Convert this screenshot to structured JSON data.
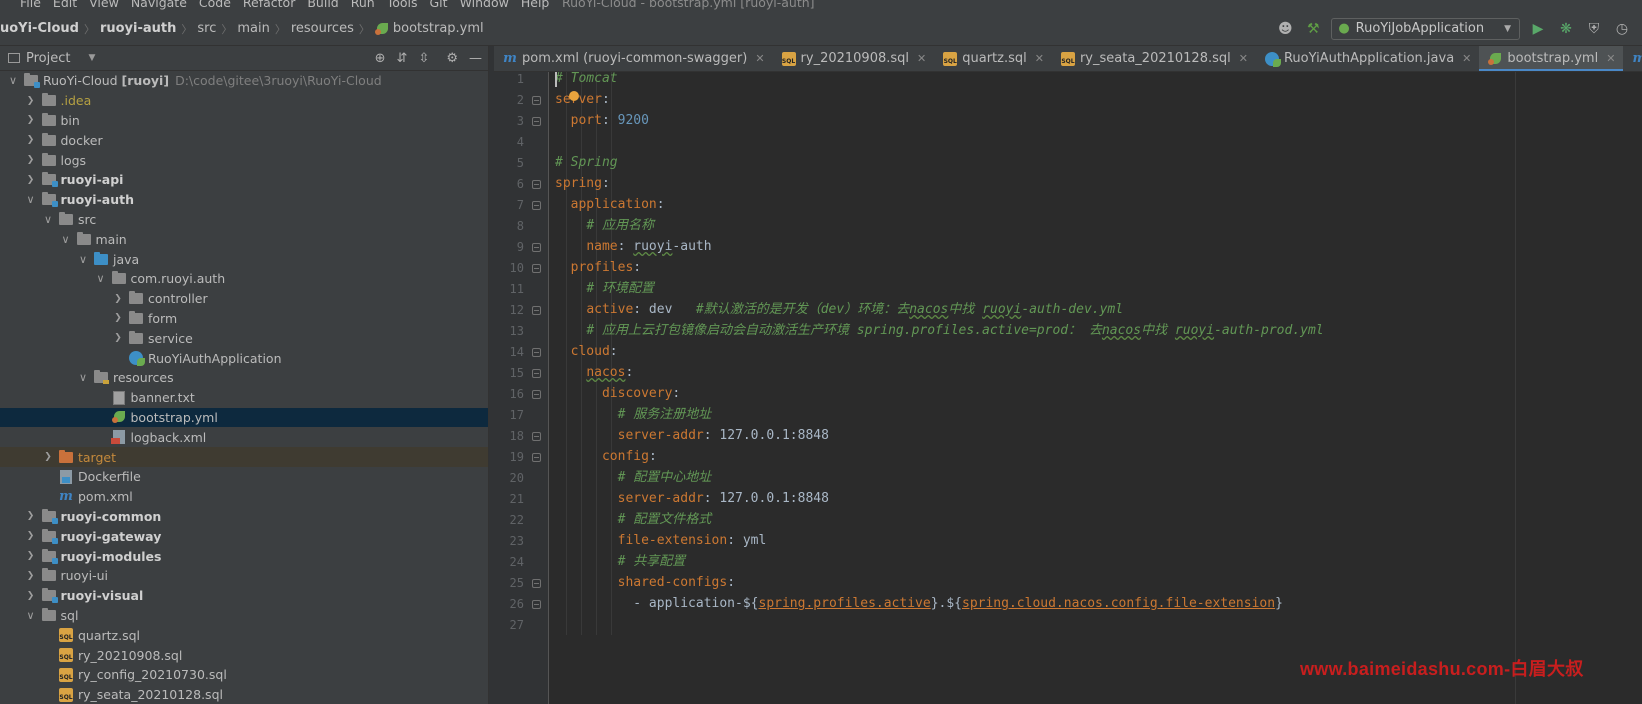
{
  "menubar": {
    "items": [
      "File",
      "Edit",
      "View",
      "Navigate",
      "Code",
      "Refactor",
      "Build",
      "Run",
      "Tools",
      "Git",
      "Window",
      "Help"
    ],
    "window_title": "RuoYi-Cloud - bootstrap.yml [ruoyi-auth]"
  },
  "breadcrumbs": [
    "uoYi-Cloud",
    "ruoyi-auth",
    "src",
    "main",
    "resources",
    "bootstrap.yml"
  ],
  "toolbar": {
    "run_config": "RuoYiJobApplication",
    "icons": [
      "user-icon",
      "hammer-icon",
      "run-icon",
      "debug-icon",
      "coverage-icon",
      "profile-icon"
    ]
  },
  "project_panel": {
    "title": "Project",
    "tree": [
      {
        "label": "RuoYi-Cloud [ruoyi]",
        "hint": "D:\\code\\gitee\\3ruoyi\\RuoYi-Cloud",
        "depth": 0,
        "arrow": "down",
        "icon": "module-folder",
        "style": "normal"
      },
      {
        "label": ".idea",
        "depth": 1,
        "arrow": "right",
        "icon": "folder",
        "style": "yellow"
      },
      {
        "label": "bin",
        "depth": 1,
        "arrow": "right",
        "icon": "folder",
        "style": "normal"
      },
      {
        "label": "docker",
        "depth": 1,
        "arrow": "right",
        "icon": "folder",
        "style": "normal"
      },
      {
        "label": "logs",
        "depth": 1,
        "arrow": "right",
        "icon": "folder",
        "style": "normal"
      },
      {
        "label": "ruoyi-api",
        "depth": 1,
        "arrow": "right",
        "icon": "module-folder",
        "style": "bold"
      },
      {
        "label": "ruoyi-auth",
        "depth": 1,
        "arrow": "down",
        "icon": "module-folder",
        "style": "bold"
      },
      {
        "label": "src",
        "depth": 2,
        "arrow": "down",
        "icon": "folder",
        "style": "normal"
      },
      {
        "label": "main",
        "depth": 3,
        "arrow": "down",
        "icon": "folder",
        "style": "normal"
      },
      {
        "label": "java",
        "depth": 4,
        "arrow": "down",
        "icon": "blue-folder",
        "style": "normal"
      },
      {
        "label": "com.ruoyi.auth",
        "depth": 5,
        "arrow": "down",
        "icon": "package",
        "style": "normal"
      },
      {
        "label": "controller",
        "depth": 6,
        "arrow": "right",
        "icon": "package",
        "style": "normal"
      },
      {
        "label": "form",
        "depth": 6,
        "arrow": "right",
        "icon": "package",
        "style": "normal"
      },
      {
        "label": "service",
        "depth": 6,
        "arrow": "right",
        "icon": "package",
        "style": "normal"
      },
      {
        "label": "RuoYiAuthApplication",
        "depth": 6,
        "arrow": "none",
        "icon": "class",
        "style": "normal"
      },
      {
        "label": "resources",
        "depth": 4,
        "arrow": "down",
        "icon": "resources-folder",
        "style": "normal"
      },
      {
        "label": "banner.txt",
        "depth": 5,
        "arrow": "none",
        "icon": "txt",
        "style": "normal"
      },
      {
        "label": "bootstrap.yml",
        "depth": 5,
        "arrow": "none",
        "icon": "yml",
        "style": "normal",
        "selected": true
      },
      {
        "label": "logback.xml",
        "depth": 5,
        "arrow": "none",
        "icon": "xml",
        "style": "normal"
      },
      {
        "label": "target",
        "depth": 2,
        "arrow": "right",
        "icon": "orange-folder",
        "style": "orange",
        "excluded": true
      },
      {
        "label": "Dockerfile",
        "depth": 2,
        "arrow": "none",
        "icon": "docker",
        "style": "normal"
      },
      {
        "label": "pom.xml",
        "depth": 2,
        "arrow": "none",
        "icon": "pom",
        "style": "normal"
      },
      {
        "label": "ruoyi-common",
        "depth": 1,
        "arrow": "right",
        "icon": "module-folder",
        "style": "bold"
      },
      {
        "label": "ruoyi-gateway",
        "depth": 1,
        "arrow": "right",
        "icon": "module-folder",
        "style": "bold"
      },
      {
        "label": "ruoyi-modules",
        "depth": 1,
        "arrow": "right",
        "icon": "module-folder",
        "style": "bold"
      },
      {
        "label": "ruoyi-ui",
        "depth": 1,
        "arrow": "right",
        "icon": "folder",
        "style": "normal"
      },
      {
        "label": "ruoyi-visual",
        "depth": 1,
        "arrow": "right",
        "icon": "module-folder",
        "style": "bold"
      },
      {
        "label": "sql",
        "depth": 1,
        "arrow": "down",
        "icon": "folder",
        "style": "normal"
      },
      {
        "label": "quartz.sql",
        "depth": 2,
        "arrow": "none",
        "icon": "sql",
        "style": "normal"
      },
      {
        "label": "ry_20210908.sql",
        "depth": 2,
        "arrow": "none",
        "icon": "sql",
        "style": "normal"
      },
      {
        "label": "ry_config_20210730.sql",
        "depth": 2,
        "arrow": "none",
        "icon": "sql",
        "style": "normal"
      },
      {
        "label": "ry_seata_20210128.sql",
        "depth": 2,
        "arrow": "none",
        "icon": "sql",
        "style": "normal"
      }
    ]
  },
  "tabs": [
    {
      "label": "pom.xml (ruoyi-common-swagger)",
      "icon": "pom",
      "active": false
    },
    {
      "label": "ry_20210908.sql",
      "icon": "sql",
      "active": false
    },
    {
      "label": "quartz.sql",
      "icon": "sql",
      "active": false
    },
    {
      "label": "ry_seata_20210128.sql",
      "icon": "sql",
      "active": false
    },
    {
      "label": "RuoYiAuthApplication.java",
      "icon": "class",
      "active": false
    },
    {
      "label": "bootstrap.yml",
      "icon": "yml",
      "active": true
    },
    {
      "label": "pom.xml (ruoyi)",
      "icon": "pom",
      "active": false
    }
  ],
  "editor": {
    "lines": [
      {
        "n": "1",
        "fold": false,
        "parts": [
          [
            "cmt",
            "# Tomcat"
          ]
        ]
      },
      {
        "n": "2",
        "fold": true,
        "parts": [
          [
            "key",
            "server"
          ],
          [
            "val",
            ":"
          ]
        ]
      },
      {
        "n": "3",
        "fold": true,
        "parts": [
          [
            "val",
            "  "
          ],
          [
            "key",
            "port"
          ],
          [
            "val",
            ": "
          ],
          [
            "num",
            "9200"
          ]
        ]
      },
      {
        "n": "4",
        "fold": false,
        "parts": []
      },
      {
        "n": "5",
        "fold": false,
        "parts": [
          [
            "cmt",
            "# Spring"
          ]
        ]
      },
      {
        "n": "6",
        "fold": true,
        "parts": [
          [
            "key",
            "spring"
          ],
          [
            "val",
            ":"
          ]
        ]
      },
      {
        "n": "7",
        "fold": true,
        "parts": [
          [
            "val",
            "  "
          ],
          [
            "key",
            "application"
          ],
          [
            "val",
            ":"
          ]
        ]
      },
      {
        "n": "8",
        "fold": false,
        "parts": [
          [
            "val",
            "    "
          ],
          [
            "cmt",
            "# 应用名称"
          ]
        ]
      },
      {
        "n": "9",
        "fold": true,
        "parts": [
          [
            "val",
            "    "
          ],
          [
            "key",
            "name"
          ],
          [
            "val",
            ": "
          ],
          [
            "val ul",
            "ruoyi"
          ],
          [
            "val",
            "-auth"
          ]
        ]
      },
      {
        "n": "10",
        "fold": true,
        "parts": [
          [
            "val",
            "  "
          ],
          [
            "key",
            "profiles"
          ],
          [
            "val",
            ":"
          ]
        ]
      },
      {
        "n": "11",
        "fold": false,
        "parts": [
          [
            "val",
            "    "
          ],
          [
            "cmt",
            "# 环境配置"
          ]
        ]
      },
      {
        "n": "12",
        "fold": true,
        "parts": [
          [
            "val",
            "    "
          ],
          [
            "key",
            "active"
          ],
          [
            "val",
            ": dev   "
          ],
          [
            "cmt",
            "#默认激活的是开发（dev）环境：去"
          ],
          [
            "cmt ul",
            "nacos"
          ],
          [
            "cmt",
            "中找 "
          ],
          [
            "cmt ul",
            "ruoyi"
          ],
          [
            "cmt",
            "-auth-dev.yml"
          ]
        ]
      },
      {
        "n": "13",
        "fold": false,
        "parts": [
          [
            "val",
            "    "
          ],
          [
            "cmt",
            "# 应用上云打包镜像启动会自动激活生产环境 spring.profiles.active=prod： 去"
          ],
          [
            "cmt ul",
            "nacos"
          ],
          [
            "cmt",
            "中找 "
          ],
          [
            "cmt ul",
            "ruoyi"
          ],
          [
            "cmt",
            "-auth-prod.yml"
          ]
        ]
      },
      {
        "n": "14",
        "fold": true,
        "parts": [
          [
            "val",
            "  "
          ],
          [
            "key",
            "cloud"
          ],
          [
            "val",
            ":"
          ]
        ]
      },
      {
        "n": "15",
        "fold": true,
        "parts": [
          [
            "val",
            "    "
          ],
          [
            "key ul",
            "nacos"
          ],
          [
            "val",
            ":"
          ]
        ]
      },
      {
        "n": "16",
        "fold": true,
        "parts": [
          [
            "val",
            "      "
          ],
          [
            "key",
            "discovery"
          ],
          [
            "val",
            ":"
          ]
        ]
      },
      {
        "n": "17",
        "fold": false,
        "parts": [
          [
            "val",
            "        "
          ],
          [
            "cmt",
            "# 服务注册地址"
          ]
        ]
      },
      {
        "n": "18",
        "fold": true,
        "parts": [
          [
            "val",
            "        "
          ],
          [
            "key",
            "server-addr"
          ],
          [
            "val",
            ": 127.0.0.1:8848"
          ]
        ]
      },
      {
        "n": "19",
        "fold": true,
        "parts": [
          [
            "val",
            "      "
          ],
          [
            "key",
            "config"
          ],
          [
            "val",
            ":"
          ]
        ]
      },
      {
        "n": "20",
        "fold": false,
        "parts": [
          [
            "val",
            "        "
          ],
          [
            "cmt",
            "# 配置中心地址"
          ]
        ]
      },
      {
        "n": "21",
        "fold": false,
        "parts": [
          [
            "val",
            "        "
          ],
          [
            "key",
            "server-addr"
          ],
          [
            "val",
            ": 127.0.0.1:8848"
          ]
        ]
      },
      {
        "n": "22",
        "fold": false,
        "parts": [
          [
            "val",
            "        "
          ],
          [
            "cmt",
            "# 配置文件格式"
          ]
        ]
      },
      {
        "n": "23",
        "fold": false,
        "parts": [
          [
            "val",
            "        "
          ],
          [
            "key",
            "file-extension"
          ],
          [
            "val",
            ": yml"
          ]
        ]
      },
      {
        "n": "24",
        "fold": false,
        "parts": [
          [
            "val",
            "        "
          ],
          [
            "cmt",
            "# 共享配置"
          ]
        ]
      },
      {
        "n": "25",
        "fold": true,
        "parts": [
          [
            "val",
            "        "
          ],
          [
            "key",
            "shared-configs"
          ],
          [
            "val",
            ":"
          ]
        ]
      },
      {
        "n": "26",
        "fold": true,
        "parts": [
          [
            "val",
            "          - application-${"
          ],
          [
            "key ul2",
            "spring.profiles.active"
          ],
          [
            "val",
            "}.${"
          ],
          [
            "key ul2",
            "spring.cloud.nacos.config.file-extension"
          ],
          [
            "val",
            "}"
          ]
        ]
      },
      {
        "n": "27",
        "fold": false,
        "parts": []
      }
    ]
  },
  "watermark": "www.baimeidashu.com-白眉大叔",
  "colors": {
    "accent": "#4a88c7",
    "selection": "#0d293e",
    "keyword": "#cc7832",
    "comment": "#629755",
    "number": "#6897bb"
  }
}
